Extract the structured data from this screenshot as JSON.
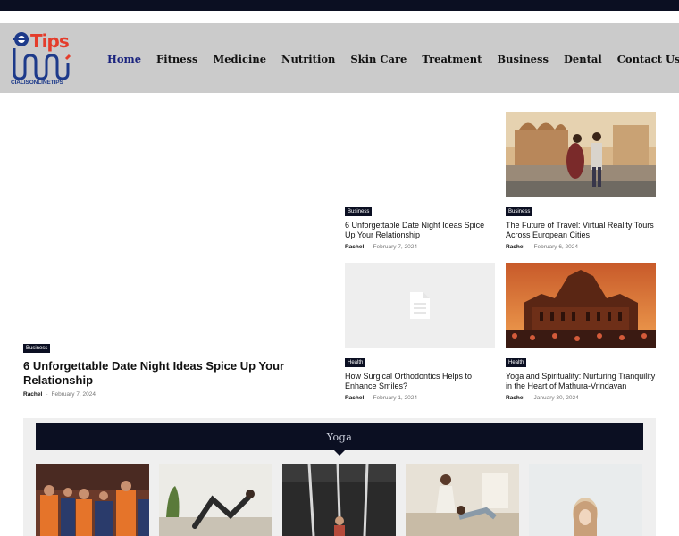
{
  "header": {
    "logo_word": "Tips",
    "logo_brand": "CIALISONLINETIPS",
    "nav": [
      "Home",
      "Fitness",
      "Medicine",
      "Nutrition",
      "Skin Care",
      "Treatment",
      "Business",
      "Dental",
      "Contact Us"
    ]
  },
  "featured": {
    "category": "Business",
    "title": "6 Unforgettable Date Night Ideas Spice Up Your Relationship",
    "author": "Rachel",
    "date": "February 7, 2024"
  },
  "posts": [
    {
      "category": "Business",
      "title": "6 Unforgettable Date Night Ideas Spice Up Your Relationship",
      "author": "Rachel",
      "date": "February 7, 2024"
    },
    {
      "category": "Business",
      "title": "The Future of Travel: Virtual Reality Tours Across European Cities",
      "author": "Rachel",
      "date": "February 6, 2024"
    },
    {
      "category": "Health",
      "title": "How Surgical Orthodontics Helps to Enhance Smiles?",
      "author": "Rachel",
      "date": "February 1, 2024"
    },
    {
      "category": "Health",
      "title": "Yoga and Spirituality: Nurturing Tranquility in the Heart of Mathura-Vrindavan",
      "author": "Rachel",
      "date": "January 30, 2024"
    }
  ],
  "yoga": {
    "heading": "Yoga"
  },
  "colors": {
    "dark": "#0b0f22",
    "header_bg": "#cbcbcb",
    "logo_red": "#e43c2b",
    "logo_blue": "#1d3a8a",
    "active_nav": "#1a237e"
  }
}
